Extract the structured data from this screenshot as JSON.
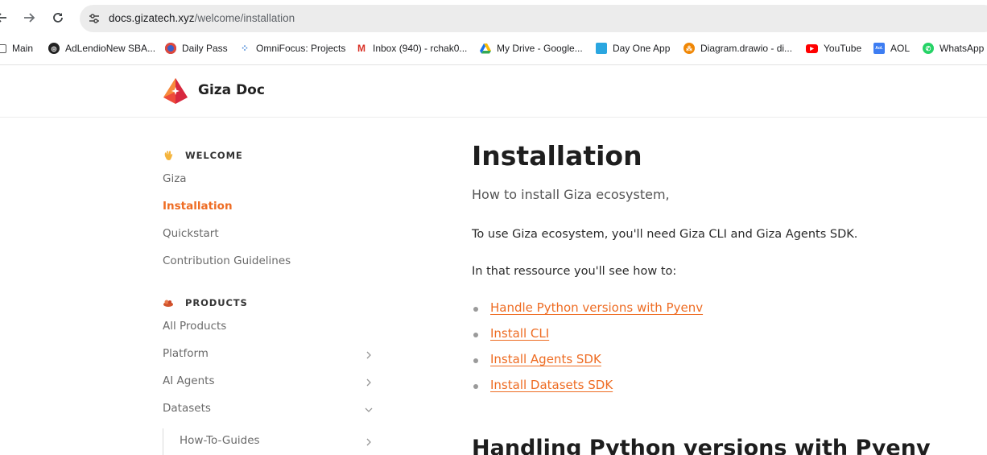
{
  "browser": {
    "url_host": "docs.gizatech.xyz",
    "url_path": "/welcome/installation",
    "bookmarks": [
      {
        "label": "Main",
        "icon": "folder-icon"
      },
      {
        "label": "AdLendioNew SBA...",
        "icon": "globe-icon"
      },
      {
        "label": "Daily Pass",
        "icon": "daily-pass-icon"
      },
      {
        "label": "OmniFocus: Projects",
        "icon": "omnifocus-icon"
      },
      {
        "label": "Inbox (940) - rchak0...",
        "icon": "gmail-icon"
      },
      {
        "label": "My Drive - Google...",
        "icon": "google-drive-icon"
      },
      {
        "label": "Day One App",
        "icon": "day-one-icon"
      },
      {
        "label": "Diagram.drawio - di...",
        "icon": "drawio-icon"
      },
      {
        "label": "YouTube",
        "icon": "youtube-icon"
      },
      {
        "label": "AOL",
        "icon": "aol-icon"
      },
      {
        "label": "WhatsApp",
        "icon": "whatsapp-icon"
      }
    ]
  },
  "site": {
    "brand": "Giza Doc",
    "accent": "#ee6c23"
  },
  "sidebar": {
    "welcome_title": "WELCOME",
    "welcome_items": [
      "Giza",
      "Installation",
      "Quickstart",
      "Contribution Guidelines"
    ],
    "active_item": "Installation",
    "products_title": "PRODUCTS",
    "products_items": [
      "All Products",
      "Platform",
      "AI Agents",
      "Datasets"
    ],
    "sub_items": [
      "How-To-Guides"
    ]
  },
  "main": {
    "title": "Installation",
    "subtitle": "How to install Giza ecosystem,",
    "para1": "To use Giza ecosystem, you'll need Giza CLI and Giza Agents SDK.",
    "para2": "In that ressource you'll see how to:",
    "links": [
      "Handle Python versions with Pyenv",
      "Install CLI",
      "Install Agents SDK",
      "Install Datasets SDK"
    ],
    "section_heading": "Handling Python versions with Pyenv"
  }
}
